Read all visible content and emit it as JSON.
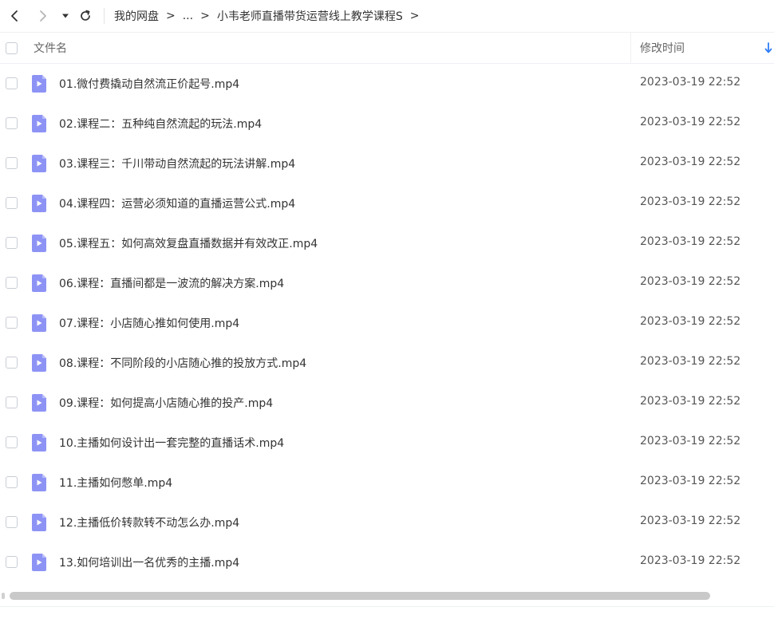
{
  "toolbar": {
    "back_icon": "chevron-left-icon",
    "forward_icon": "chevron-right-icon",
    "dropdown_icon": "caret-down-icon",
    "refresh_icon": "refresh-icon"
  },
  "breadcrumb": {
    "root": "我的网盘",
    "ellipsis": "...",
    "current": "小韦老师直播带货运营线上教学课程S",
    "separator": ">"
  },
  "table": {
    "columns": {
      "name": "文件名",
      "modified": "修改时间"
    },
    "sort_icon": "arrow-down-icon",
    "sort_color": "#2f7df6",
    "file_icon": "video-file-icon",
    "file_icon_color": "#8d93f5",
    "rows": [
      {
        "name": "01.微付费撬动自然流正价起号.mp4",
        "modified": "2023-03-19 22:52"
      },
      {
        "name": "02.课程二：五种纯自然流起的玩法.mp4",
        "modified": "2023-03-19 22:52"
      },
      {
        "name": "03.课程三：千川带动自然流起的玩法讲解.mp4",
        "modified": "2023-03-19 22:52"
      },
      {
        "name": "04.课程四：运营必须知道的直播运营公式.mp4",
        "modified": "2023-03-19 22:52"
      },
      {
        "name": "05.课程五：如何高效复盘直播数据并有效改正.mp4",
        "modified": "2023-03-19 22:52"
      },
      {
        "name": "06.课程：直播间都是一波流的解决方案.mp4",
        "modified": "2023-03-19 22:52"
      },
      {
        "name": "07.课程：小店随心推如何使用.mp4",
        "modified": "2023-03-19 22:52"
      },
      {
        "name": "08.课程：不同阶段的小店随心推的投放方式.mp4",
        "modified": "2023-03-19 22:52"
      },
      {
        "name": "09.课程：如何提高小店随心推的投产.mp4",
        "modified": "2023-03-19 22:52"
      },
      {
        "name": "10.主播如何设计出一套完整的直播话术.mp4",
        "modified": "2023-03-19 22:52"
      },
      {
        "name": "11.主播如何憋单.mp4",
        "modified": "2023-03-19 22:52"
      },
      {
        "name": "12.主播低价转款转不动怎么办.mp4",
        "modified": "2023-03-19 22:52"
      },
      {
        "name": "13.如何培训出一名优秀的主播.mp4",
        "modified": "2023-03-19 22:52"
      }
    ]
  }
}
